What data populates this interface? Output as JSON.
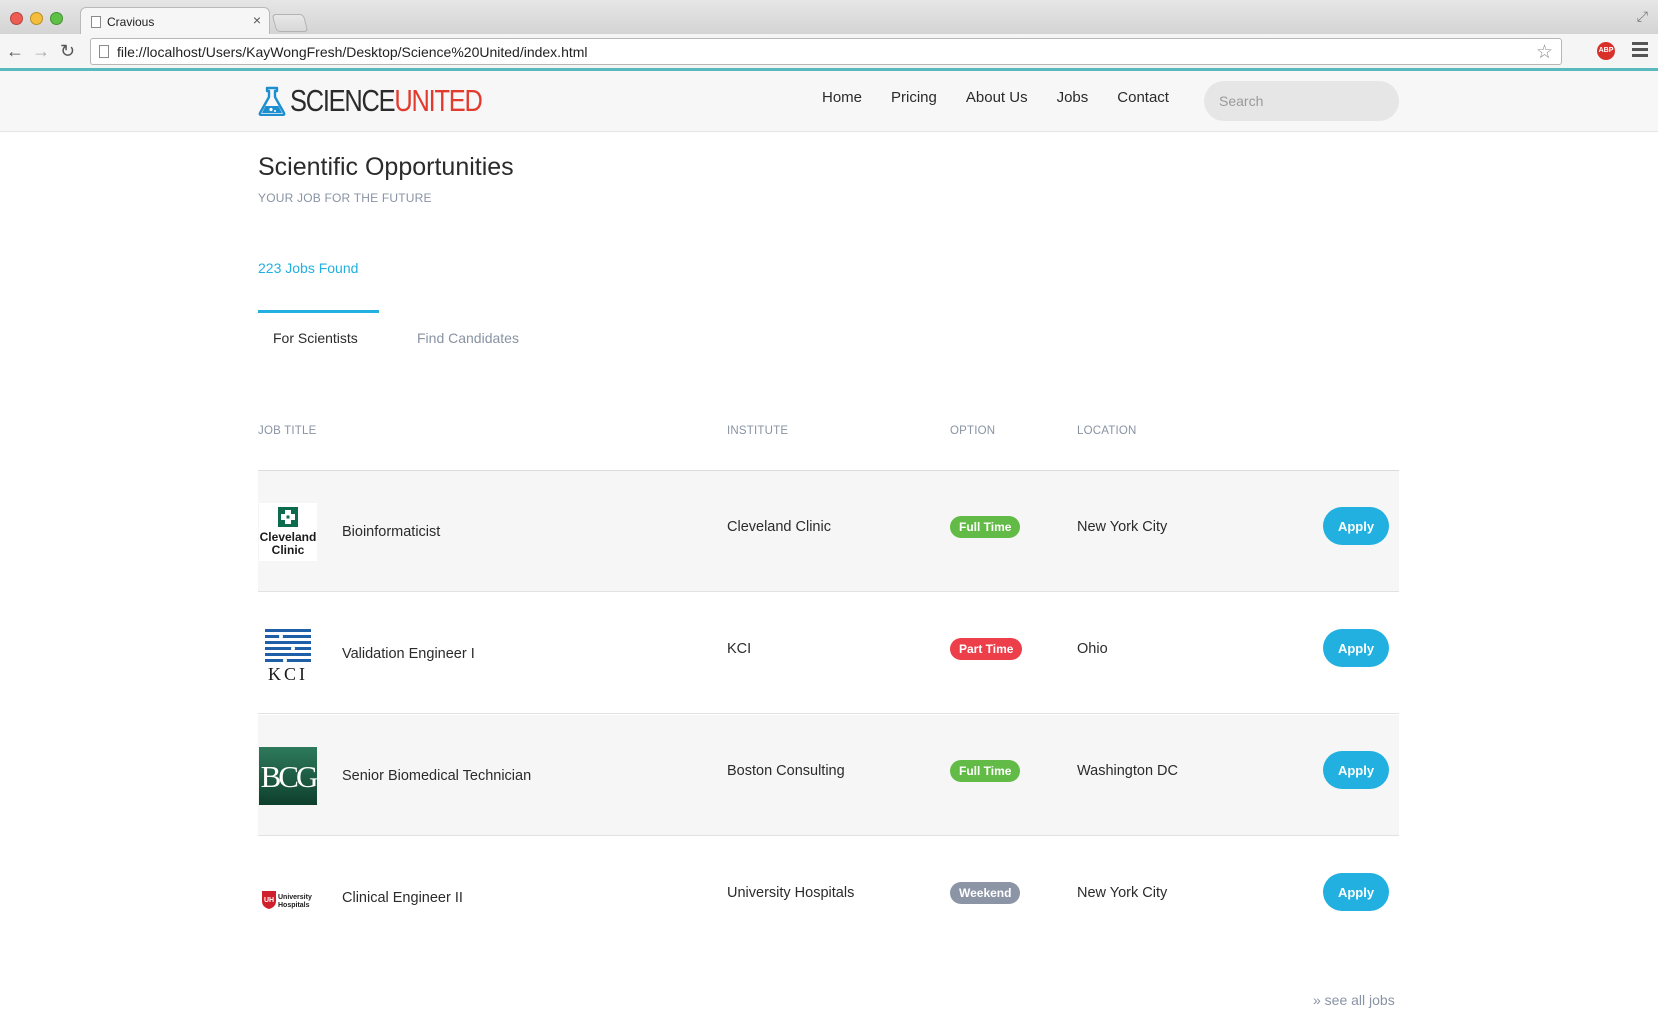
{
  "browser": {
    "tab_title": "Cravious",
    "tab_close": "×",
    "url": "file://localhost/Users/KayWongFresh/Desktop/Science%20United/index.html",
    "abp_label": "ABP"
  },
  "site": {
    "logo_part1": "SCIENCE",
    "logo_part2": "UNITED",
    "nav": [
      "Home",
      "Pricing",
      "About Us",
      "Jobs",
      "Contact"
    ],
    "search_placeholder": "Search"
  },
  "main": {
    "title": "Scientific Opportunities",
    "subtitle": "YOUR JOB FOR THE FUTURE",
    "jobs_found": "223 Jobs Found",
    "tabs": [
      {
        "label": "For Scientists",
        "active": true
      },
      {
        "label": "Find Candidates",
        "active": false
      }
    ],
    "columns": {
      "title": "JOB TITLE",
      "institute": "INSTITUTE",
      "option": "OPTION",
      "location": "LOCATION"
    },
    "jobs": [
      {
        "title": "Bioinformaticist",
        "institute": "Cleveland Clinic",
        "option": "Full Time",
        "location": "New York City",
        "apply": "Apply",
        "logo": "cleveland-clinic-logo",
        "logo_text": "Cleveland Clinic"
      },
      {
        "title": "Validation Engineer I",
        "institute": "KCI",
        "option": "Part Time",
        "location": "Ohio",
        "apply": "Apply",
        "logo": "kci-logo",
        "logo_text": "KCI"
      },
      {
        "title": "Senior Biomedical Technician",
        "institute": "Boston Consulting",
        "option": "Full Time",
        "location": "Washington DC",
        "apply": "Apply",
        "logo": "bcg-logo",
        "logo_text": "BCG"
      },
      {
        "title": "Clinical Engineer II",
        "institute": "University Hospitals",
        "option": "Weekend",
        "location": "New York City",
        "apply": "Apply",
        "logo": "university-hospitals-logo",
        "logo_text": "University Hospitals"
      }
    ],
    "see_all": "» see all jobs"
  },
  "colors": {
    "accent": "#21b0df",
    "logo_red": "#e23b2e",
    "full_time": "#62bb46",
    "part_time": "#ec3f4a",
    "weekend": "#8c95a6"
  }
}
